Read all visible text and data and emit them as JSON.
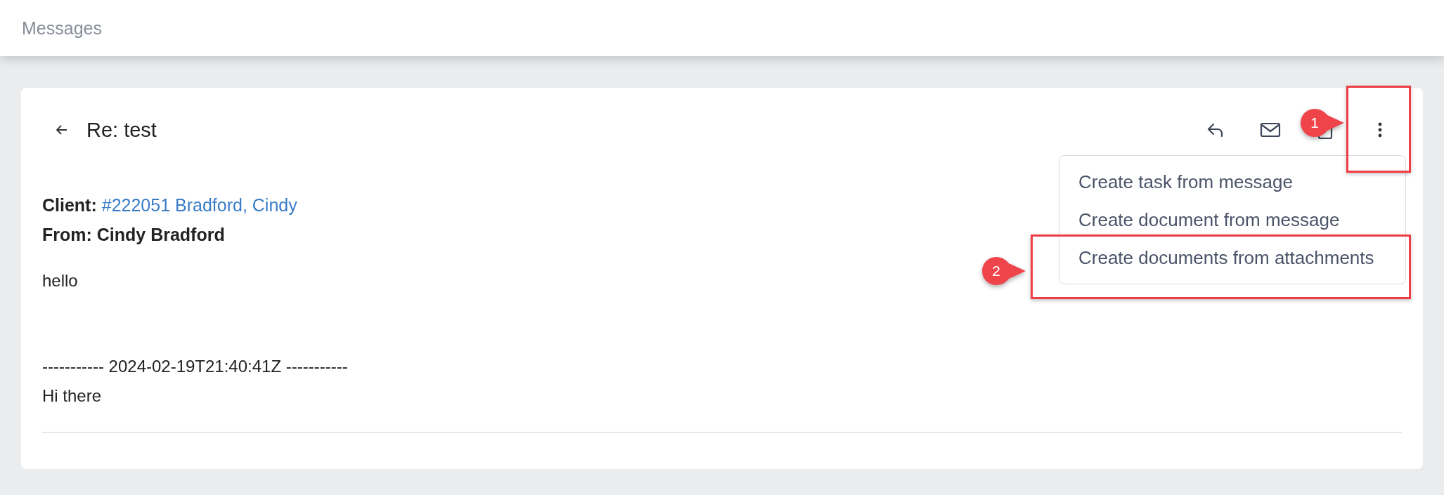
{
  "header": {
    "title": "Messages"
  },
  "message": {
    "subject": "Re: test",
    "client_label": "Client:",
    "client_link": "#222051 Bradford, Cindy",
    "from": "From: Cindy Bradford",
    "paragraphs": [
      {
        "lines": [
          "hello"
        ]
      },
      {
        "lines": [
          "----------- 2024-02-19T21:40:41Z -----------",
          "Hi there"
        ]
      }
    ]
  },
  "menu": {
    "items": [
      "Create task from message",
      "Create document from message",
      "Create documents from attachments"
    ]
  },
  "annotations": [
    {
      "number": "1"
    },
    {
      "number": "2"
    }
  ]
}
